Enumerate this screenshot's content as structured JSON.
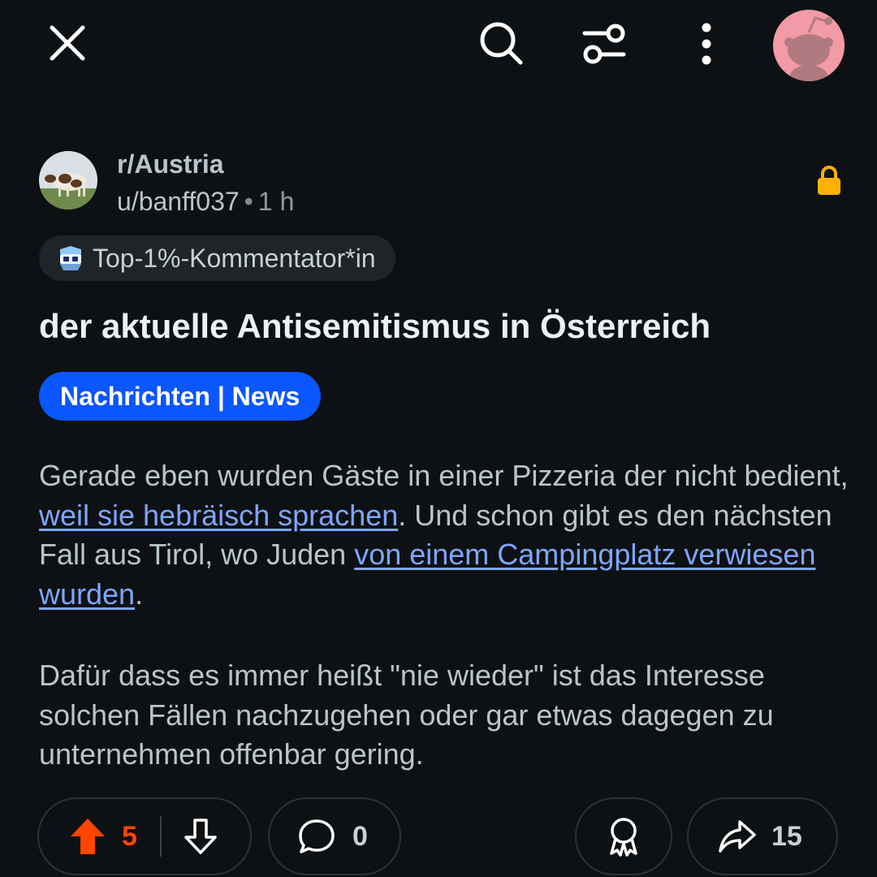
{
  "toolbar": {
    "icons": [
      "close-icon",
      "search-icon",
      "filter-icon",
      "more-icon",
      "user-avatar"
    ]
  },
  "post": {
    "subreddit": "r/Austria",
    "author": "u/banff037",
    "separator": "•",
    "time": "1 h",
    "locked": true,
    "badge": "Top-1%-Kommentator*in",
    "title": "der aktuelle Antisemitismus in Österreich",
    "flair": "Nachrichten | News",
    "body": {
      "p1_before": "Gerade eben wurden Gäste in einer Pizzeria der nicht bedient, ",
      "p1_link1": "weil sie hebräisch sprachen",
      "p1_middle": ". Und schon gibt es den nächsten Fall aus Tirol, wo Juden ",
      "p1_link2": "von einem Campingplatz verwiesen wurden",
      "p1_after": ".",
      "p2": "Dafür dass es immer heißt \"nie wieder\" ist das Interesse solchen Fällen nachzugehen oder gar etwas dagegen zu unternehmen offenbar gering."
    }
  },
  "actions": {
    "upvotes": "5",
    "comments": "0",
    "shares": "15"
  },
  "colors": {
    "background": "#0e1113",
    "upvote_active": "#ff4500",
    "flair": "#0a56ff",
    "link": "#7ea6ff",
    "lock": "#ffb000"
  }
}
